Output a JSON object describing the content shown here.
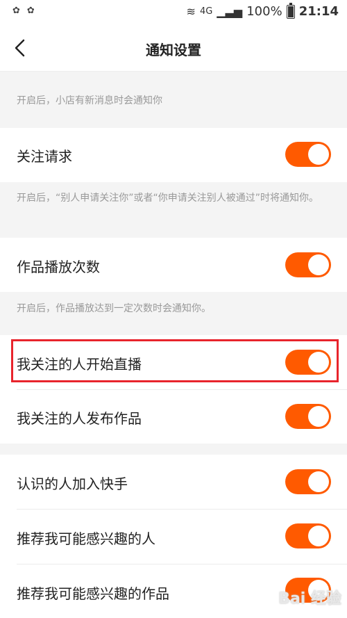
{
  "status_bar": {
    "battery": "100%",
    "time": "21:14",
    "network": "4G"
  },
  "header": {
    "title": "通知设置"
  },
  "notes": {
    "shop": "开启后，小店有新消息时会通知你",
    "follow": "开启后，“别人申请关注你”或者“你申请关注别人被通过”时将通知你。",
    "plays": "开启后，作品播放达到一定次数时会通知你。"
  },
  "settings": [
    {
      "label": "关注请求",
      "on": true
    },
    {
      "label": "作品播放次数",
      "on": true
    },
    {
      "label": "我关注的人开始直播",
      "on": true
    },
    {
      "label": "我关注的人发布作品",
      "on": true
    },
    {
      "label": "认识的人加入快手",
      "on": true
    },
    {
      "label": "推荐我可能感兴趣的人",
      "on": true
    },
    {
      "label": "推荐我可能感兴趣的作品",
      "on": true
    }
  ],
  "accent_color": "#ff5a00",
  "highlight_color": "#e8242c",
  "watermark": "Bai 经验"
}
